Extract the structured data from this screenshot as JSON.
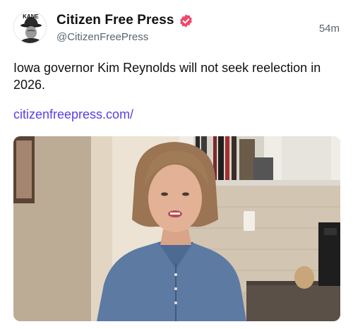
{
  "account": {
    "display_name": "Citizen Free Press",
    "handle": "@CitizenFreePress",
    "avatar_text": "KANE"
  },
  "post": {
    "timestamp": "54m",
    "text": "Iowa governor Kim Reynolds will not seek reelection in 2026.",
    "link_text": "citizenfreepress.com/"
  },
  "colors": {
    "link": "#5a3ee6",
    "verified_badge": "#ec4a6a"
  },
  "icons": {
    "verified": "verified-badge-icon"
  }
}
